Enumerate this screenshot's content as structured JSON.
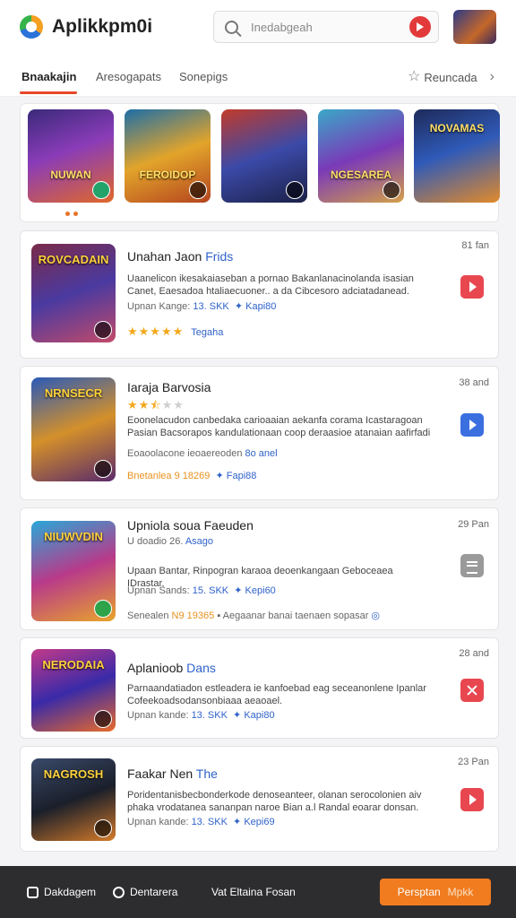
{
  "app": {
    "title": "Aplikkpm0i"
  },
  "search": {
    "placeholder": "Inedabgeah"
  },
  "tabs": [
    {
      "label": "Bnaakajin",
      "active": true
    },
    {
      "label": "Aresogapats",
      "active": false
    },
    {
      "label": "Sonepigs",
      "active": false
    }
  ],
  "tab_right": {
    "label": "Reuncada"
  },
  "featured": [
    {
      "label": "NUWAN",
      "art": "purple-hero"
    },
    {
      "label": "FEROIDOP",
      "art": "golden-warrior"
    },
    {
      "label": "",
      "art": "space-fighter"
    },
    {
      "label": "NGESAREA",
      "art": "purple-squad"
    },
    {
      "label": "NOVAMAS",
      "art": "blue-knight"
    }
  ],
  "cards": [
    {
      "thumb_text": "ROVCADAIN",
      "title_pre": "Unahan Jaon ",
      "title_accent": "Frids",
      "time": "81 fan",
      "desc": "Uaanelicon ikesakaiaseban a pornao Bakanlanacinolanda isasian Canet, Eaesadoa htaliaecuoner.. a da Cibcesoro adciatadanead.",
      "meta": "Upnan Kange: ",
      "meta_num": "13. SKK",
      "meta_tag": "Kapi80",
      "rating": 5,
      "rating_label": "Tegaha",
      "action": "play",
      "action_color": "#e8474f"
    },
    {
      "thumb_text": "NRNSECR",
      "title_pre": "Iaraja Barvosia",
      "title_accent": "",
      "time": "38 and",
      "desc": "Eoonelacudon canbedaka carioaaian aekanfa corama Icastaragoan Pasian Bacsorapos kandulationaan coop deraasioe atanaian aafirfadi",
      "meta": "Eoaoolacone ieoaereoden ",
      "meta_num": "",
      "meta_tag": "8o anel",
      "meta2_pre": "Bnetanlea ",
      "meta2_num": "9 18269",
      "meta2_tag": "Fapi88",
      "rating": 2,
      "rating_label": "",
      "action": "play",
      "action_color": "#3b6fe0"
    },
    {
      "thumb_text": "NIUWVDIN",
      "title_pre": "Upniola soua Faeuden",
      "title_accent": "",
      "subtitle": "U doadio 26. ",
      "subtitle_accent": "Asago",
      "time": "29 Pan",
      "desc": "Upaan Bantar, Rinpogran karaoa deoenkangaan Geboceaea IDrastar.",
      "meta": "Upnan Sands: ",
      "meta_num": "15. SKK",
      "meta_tag": "Kepi60",
      "meta2_pre": "Senealen ",
      "meta2_num": "N9 19365",
      "meta2_tag": "Aegaanar banai taenaen sopasar",
      "rating": 0,
      "rating_label": "",
      "action": "list",
      "action_color": "#9a9a9a"
    },
    {
      "thumb_text": "NERODAIA",
      "title_pre": "Aplanioob ",
      "title_accent": "Dans",
      "time": "28 and",
      "desc": "Parnaandatiadon estleadera ie kanfoebad eag seceanonlene Ipanlar Cofeekoadsodansonbiaaa aeaoael.",
      "meta": "Upnan kande: ",
      "meta_num": "13. SKK",
      "meta_tag": "Kapi80",
      "rating": 0,
      "rating_label": "",
      "action": "x",
      "action_color": "#e8474f"
    },
    {
      "thumb_text": "NAGROSH",
      "title_pre": "Faakar Nen ",
      "title_accent": "The",
      "time": "23 Pan",
      "desc": "Poridentanisbecbonderkode denoseanteer, olanan serocolonien aiv phaka vrodatanea sananpan naroe Bian a.l Randal eoarar donsan.",
      "meta": "Upnan kande: ",
      "meta_num": "13. SKK",
      "meta_tag": "Kepi69",
      "rating": 0,
      "rating_label": "",
      "action": "play",
      "action_color": "#e8474f"
    }
  ],
  "bottom_bar": {
    "item1": "Dakdagem",
    "item2": "Dentarera",
    "item3": "Vat Eltaina Fosan",
    "cta": "Persptan",
    "cta_dim": "Mpkk"
  }
}
